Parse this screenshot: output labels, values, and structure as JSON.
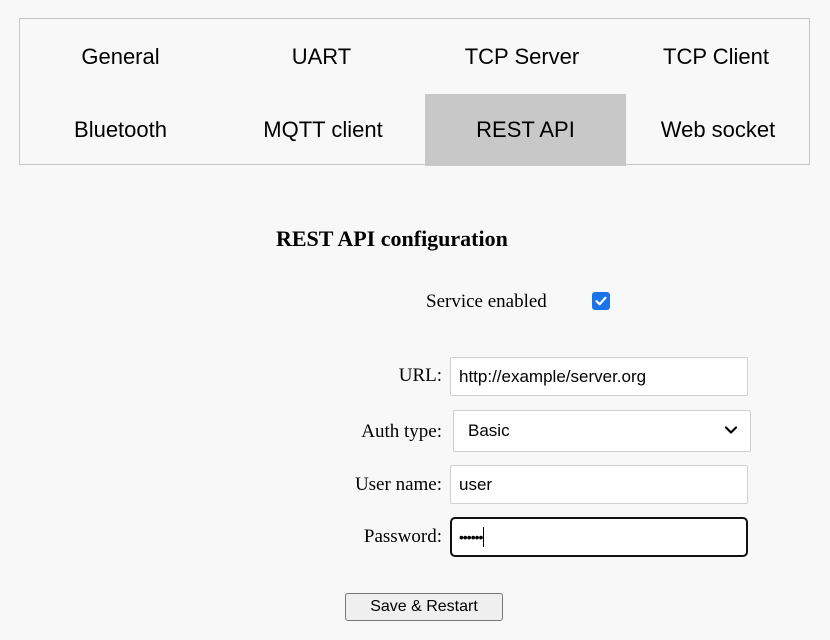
{
  "tabs": [
    {
      "label": "General",
      "active": false
    },
    {
      "label": "UART",
      "active": false
    },
    {
      "label": "TCP Server",
      "active": false
    },
    {
      "label": "TCP Client",
      "active": false
    },
    {
      "label": "Bluetooth",
      "active": false
    },
    {
      "label": "MQTT client",
      "active": false
    },
    {
      "label": "REST API",
      "active": true
    },
    {
      "label": "Web socket",
      "active": false
    }
  ],
  "page": {
    "heading": "REST API configuration"
  },
  "service": {
    "label": "Service enabled",
    "checked": true,
    "icon": "checkmark-icon"
  },
  "form": {
    "url_label": "URL:",
    "url_value": "http://example/server.org",
    "auth_label": "Auth type:",
    "auth_value": "Basic",
    "username_label": "User name:",
    "username_value": "user",
    "password_label": "Password:",
    "password_value": "••••••"
  },
  "actions": {
    "save_label": "Save & Restart"
  },
  "colors": {
    "active_tab": "#c8c8c8",
    "checkbox": "#1a73e8",
    "background": "#f8f8f8"
  }
}
